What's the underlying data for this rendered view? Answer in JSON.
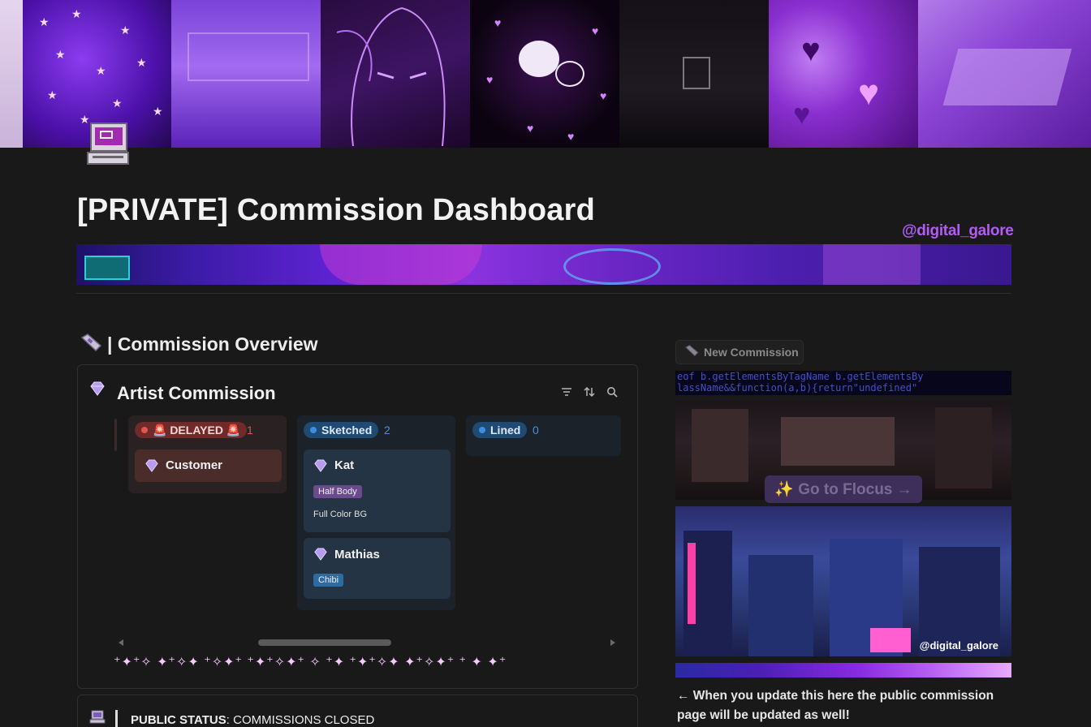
{
  "page": {
    "title": "[PRIVATE] Commission Dashboard",
    "handle": "@digital_galore"
  },
  "section": {
    "title": "| Commission Overview"
  },
  "board": {
    "title": "Artist Commission",
    "columns": [
      {
        "label": "🚨 DELAYED 🚨",
        "count": "1",
        "color": "#e0564c",
        "cards": [
          {
            "name": "Customer"
          }
        ]
      },
      {
        "label": "Sketched",
        "count": "2",
        "color": "#3b8fde",
        "cards": [
          {
            "name": "Kat",
            "tag": "Half Body",
            "note": "Full Color BG"
          },
          {
            "name": "Mathias",
            "tag": "Chibi"
          }
        ]
      },
      {
        "label": "Lined",
        "count": "0",
        "color": "#3b8fde",
        "cards": []
      }
    ],
    "sparkles": "⁺✦⁺✧ ✦⁺✧✦ ⁺✧✦⁺ ⁺✦⁺✧✦⁺ ✧ ⁺✦ ⁺✦⁺✧✦ ✦⁺✧✦⁺ ⁺ ✦ ✦⁺"
  },
  "status": {
    "label": "PUBLIC STATUS",
    "value": ": COMMISSIONS CLOSED"
  },
  "right": {
    "new_button": "New Commission",
    "code_line1": "eof b.getElementsByTagName b.getElementsBy",
    "code_line2": "lassName&&function(a,b){return\"undefined\"",
    "focus_button": "✨ Go to Flocus →",
    "city_handle": "@digital_galore",
    "note": "← When you update this here the public commission page will be updated as well!"
  },
  "icons": {
    "page_icon": "retro-computer-icon",
    "section_icon": "phone-icon",
    "board_icon": "gem-icon",
    "filter": "filter-icon",
    "sort": "sort-icon",
    "search": "search-icon",
    "status_icon": "computer-icon"
  },
  "colors": {
    "background": "#191919",
    "accent_purple": "#b15cf3",
    "delayed_red": "#e0564c",
    "status_blue": "#3b8fde"
  }
}
